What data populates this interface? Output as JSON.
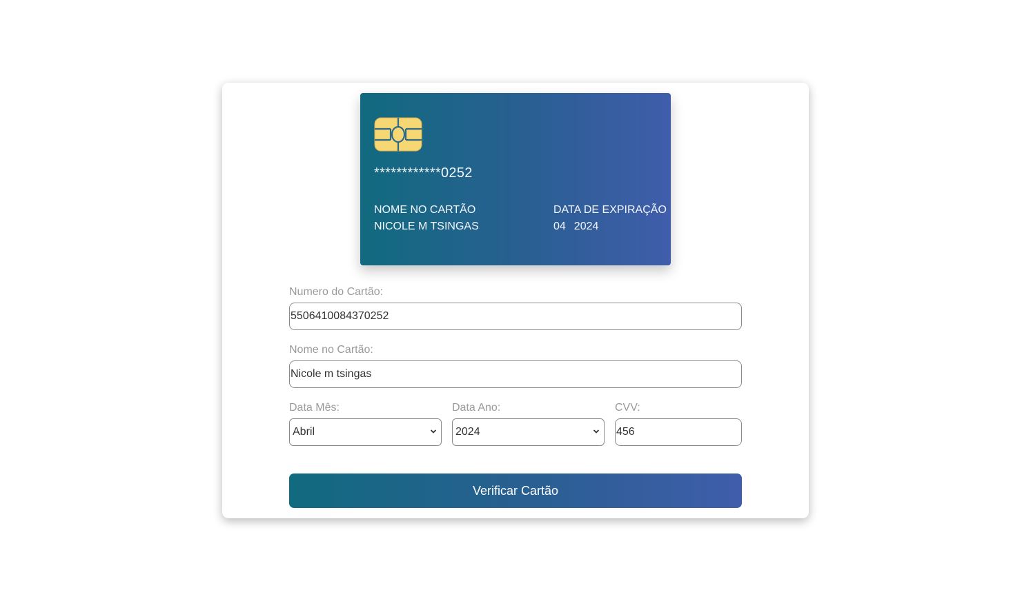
{
  "card_preview": {
    "masked_number": "************0252",
    "name_label": "NOME NO CARTÃO",
    "name_value": "NICOLE M TSINGAS",
    "expiry_label": "DATA DE EXPIRAÇÃO",
    "expiry_month": "04",
    "expiry_year": "2024",
    "gradient_start": "#116a7f",
    "gradient_end": "#405dab",
    "chip_color": "#f7d774"
  },
  "form": {
    "card_number_label": "Numero do Cartão:",
    "card_number_value": "5506410084370252",
    "card_name_label": "Nome no Cartão:",
    "card_name_value": "Nicole m tsingas",
    "month_label": "Data Mês:",
    "month_value": "Abril",
    "year_label": "Data Ano:",
    "year_value": "2024",
    "cvv_label": "CVV:",
    "cvv_value": "456",
    "submit_label": "Verificar Cartão"
  }
}
